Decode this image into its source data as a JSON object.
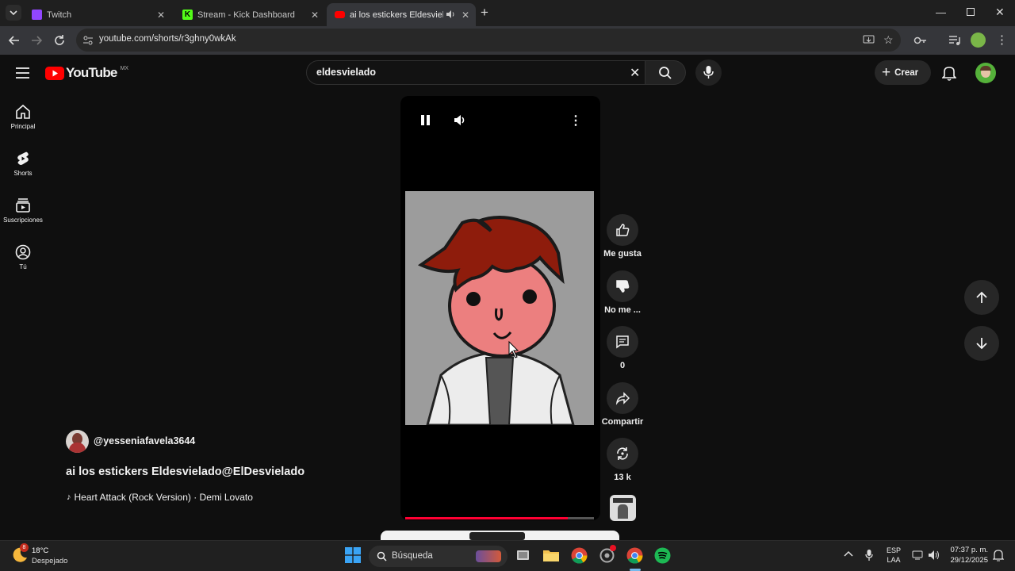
{
  "browser": {
    "tabs": [
      {
        "title": "Twitch",
        "favicon": "twitch-icon",
        "color": "#9146ff"
      },
      {
        "title": "Stream - Kick Dashboard",
        "favicon": "kick-icon",
        "color": "#53fc18"
      },
      {
        "title": "ai los estickers Eldesvielado",
        "favicon": "youtube-icon",
        "color": "#ff0000",
        "active": true
      }
    ],
    "new_tab": "+",
    "url": "youtube.com/shorts/r3ghny0wkAk"
  },
  "youtube": {
    "logo_text": "YouTube",
    "region": "MX",
    "search_value": "eldesvielado",
    "create_label": "Crear",
    "sidebar": [
      {
        "label": "Principal",
        "icon": "home-icon"
      },
      {
        "label": "Shorts",
        "icon": "shorts-icon"
      },
      {
        "label": "Suscripciones",
        "icon": "subscriptions-icon"
      },
      {
        "label": "Tú",
        "icon": "you-icon"
      }
    ],
    "short": {
      "channel": "@yesseniafavela3644",
      "title": "ai los estickers Eldesvielado@ElDesvielado",
      "music": "Heart Attack (Rock Version) · Demi Lovato",
      "progress_pct": 86
    },
    "actions": {
      "like": "Me gusta",
      "dislike": "No me ...",
      "comments": "0",
      "share": "Compartir",
      "remix": "13 k"
    }
  },
  "taskbar": {
    "weather_temp": "18°C",
    "weather_desc": "Despejado",
    "weather_badge": "8",
    "search_placeholder": "Búsqueda",
    "lang_top": "ESP",
    "lang_bottom": "LAA",
    "time": "07:37 p. m.",
    "date": "29/12/2025"
  },
  "colors": {
    "accent": "#ff0033",
    "youtube_red": "#ff0000",
    "spotify": "#1db954"
  }
}
